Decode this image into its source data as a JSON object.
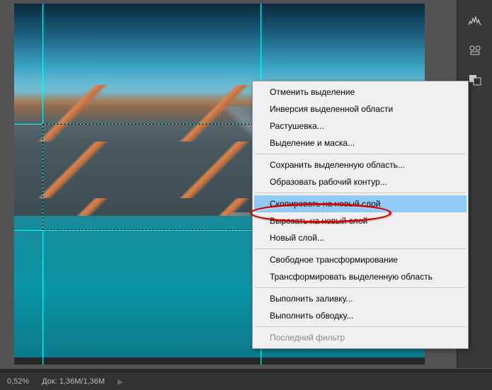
{
  "status": {
    "zoom": "0,52%",
    "doc_label": "Док:",
    "doc_value": "1,36M/1,36M",
    "arrow": "▶"
  },
  "context_menu": {
    "deselect": "Отменить выделение",
    "invert": "Инверсия выделенной области",
    "feather": "Растушевка...",
    "select_mask": "Выделение и маска...",
    "save_selection": "Сохранить выделенную область...",
    "make_work_path": "Образовать рабочий контур...",
    "copy_layer": "Скопировать на новый слой",
    "cut_layer": "Вырезать на новый слой",
    "new_layer": "Новый слой...",
    "free_transform": "Свободное трансформирование",
    "transform_selection": "Трансформировать выделенную область",
    "fill": "Выполнить заливку...",
    "stroke": "Выполнить обводку...",
    "last_filter": "Последний фильтр"
  },
  "icons": {
    "histogram": "histogram-icon",
    "adjustments": "adjustments-icon",
    "swatches": "swatches-icon"
  }
}
